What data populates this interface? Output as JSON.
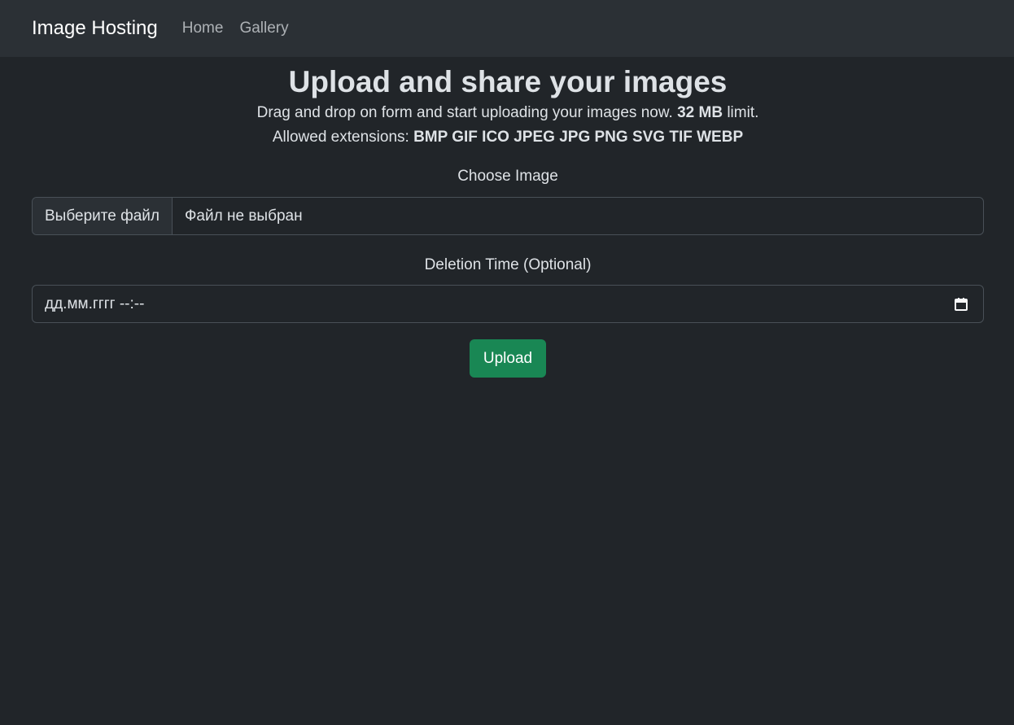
{
  "navbar": {
    "brand": "Image Hosting",
    "links": [
      {
        "label": "Home"
      },
      {
        "label": "Gallery"
      }
    ]
  },
  "header": {
    "title": "Upload and share your images",
    "subtitle_prefix": "Drag and drop on form and start uploading your images now.",
    "size_limit": "32 MB",
    "subtitle_suffix": "limit.",
    "extensions_label": "Allowed extensions:",
    "extensions": "BMP GIF ICO JPEG JPG PNG SVG TIF WEBP"
  },
  "form": {
    "image_label": "Choose Image",
    "file_button_label": "Выберите файл",
    "file_status": "Файл не выбран",
    "deletion_label": "Deletion Time (Optional)",
    "date_placeholder": "дд.мм.гггг --:--",
    "calendar_icon": "calendar-icon",
    "upload_label": "Upload"
  },
  "colors": {
    "background": "#212529",
    "navbar": "#2b3035",
    "upload_button": "#198754"
  }
}
